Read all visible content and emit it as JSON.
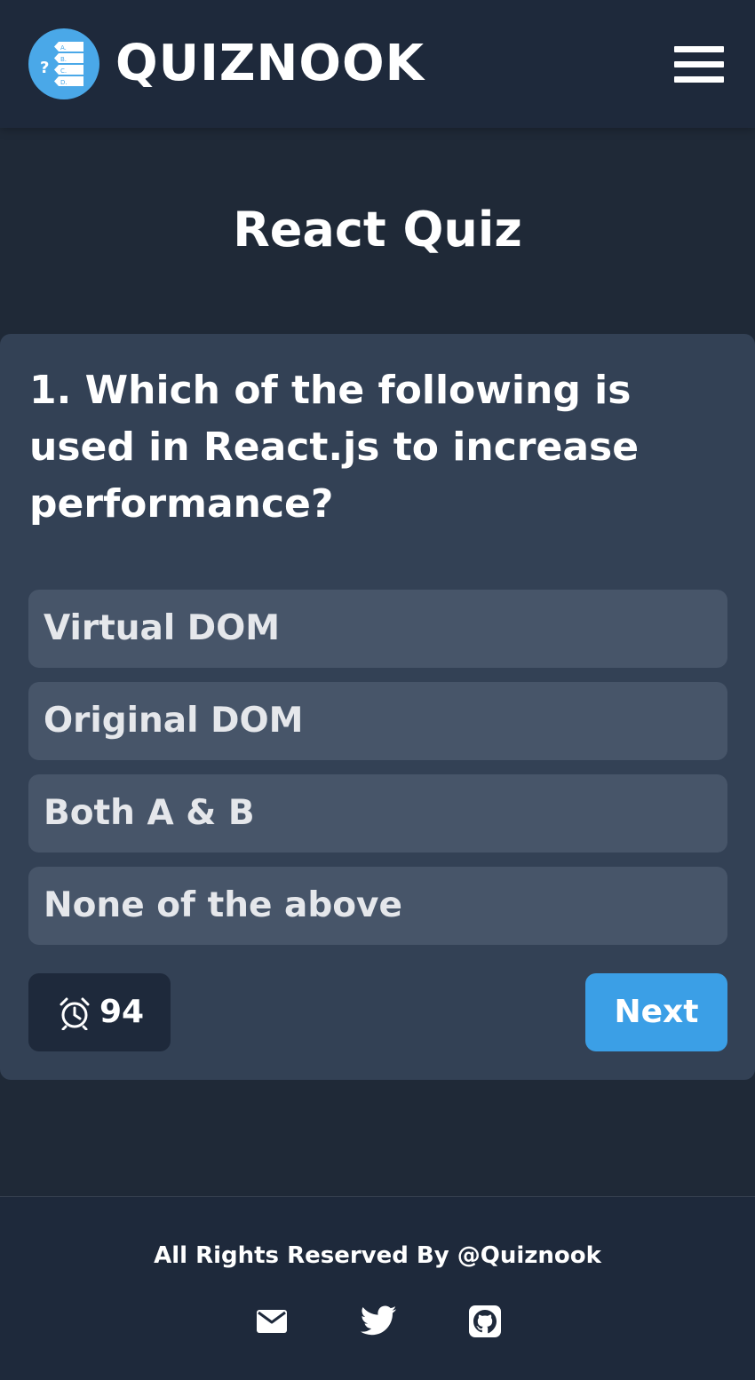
{
  "header": {
    "brand": "QUIZNOOK",
    "logo_icon": "quiz-list-icon",
    "menu_icon": "hamburger-menu-icon"
  },
  "quiz": {
    "title": "React Quiz",
    "question": "1. Which of the following is used in React.js to increase performance?",
    "options": [
      {
        "label": "Virtual DOM"
      },
      {
        "label": "Original DOM"
      },
      {
        "label": "Both A & B"
      },
      {
        "label": "None of the above"
      }
    ],
    "timer": {
      "icon": "alarm-clock-icon",
      "value": "94"
    },
    "next_label": "Next"
  },
  "footer": {
    "copyright": "All Rights Reserved By @Quiznook",
    "links": [
      {
        "icon": "mail-icon"
      },
      {
        "icon": "twitter-icon"
      },
      {
        "icon": "github-icon"
      }
    ]
  },
  "colors": {
    "background": "#1f2937",
    "header": "#1e293b",
    "card": "#334155",
    "option": "#475569",
    "accent": "#3b9fe6",
    "logo": "#4aa8e8"
  }
}
